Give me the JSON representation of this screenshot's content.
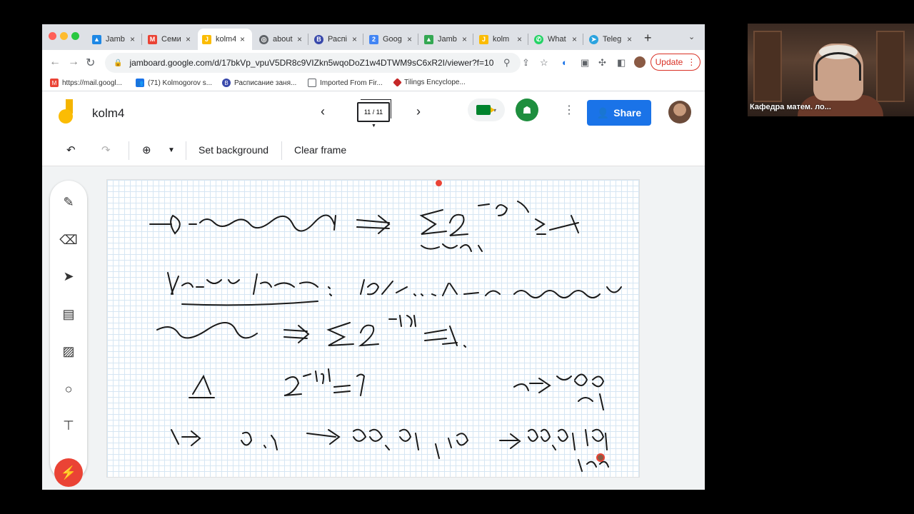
{
  "browser": {
    "tabs": [
      {
        "label": "Jamb",
        "icon": "jamboard-icon",
        "color": "#1e88e5"
      },
      {
        "label": "Семи",
        "icon": "gmail-icon",
        "color": "#ea4335"
      },
      {
        "label": "kolm4",
        "icon": "jamboard-icon",
        "color": "#fbbc04",
        "active": true
      },
      {
        "label": "about",
        "icon": "globe-icon",
        "color": "#5f6368"
      },
      {
        "label": "Распі",
        "icon": "schedule-icon",
        "color": "#3949ab"
      },
      {
        "label": "Goog",
        "icon": "calendar-icon",
        "color": "#4285f4"
      },
      {
        "label": "Jamb",
        "icon": "drive-icon",
        "color": "#34a853"
      },
      {
        "label": "kolm",
        "icon": "jamboard-icon",
        "color": "#fbbc04"
      },
      {
        "label": "What",
        "icon": "whatsapp-icon",
        "color": "#25d366"
      },
      {
        "label": "Teleg",
        "icon": "telegram-icon",
        "color": "#2aa3df"
      }
    ],
    "new_tab": "+",
    "url": "jamboard.google.com/d/17bkVp_vpuV5DR8c9VIZkn5wqoDoZ1w4DTWM9sC6xR2I/viewer?f=10",
    "update_label": "Update",
    "bookmarks": [
      {
        "label": "https://mail.googl...",
        "icon": "gmail-icon",
        "color": "#ea4335"
      },
      {
        "label": "(71) Kolmogorov s...",
        "icon": "group-icon",
        "color": "#1a73e8"
      },
      {
        "label": "Расписание заня...",
        "icon": "schedule-icon",
        "color": "#3949ab"
      },
      {
        "label": "Imported From Fir...",
        "icon": "folder-icon",
        "color": "#5f6368"
      },
      {
        "label": "Tilings Encyclope...",
        "icon": "tiling-icon",
        "color": "#c62828"
      }
    ]
  },
  "app": {
    "title": "kolm4",
    "frame_indicator": "11 / 11",
    "share_label": "Share",
    "toolbar": {
      "set_background": "Set background",
      "clear_frame": "Clear frame"
    }
  },
  "video": {
    "participant": "Кафедра матем. ло..."
  }
}
